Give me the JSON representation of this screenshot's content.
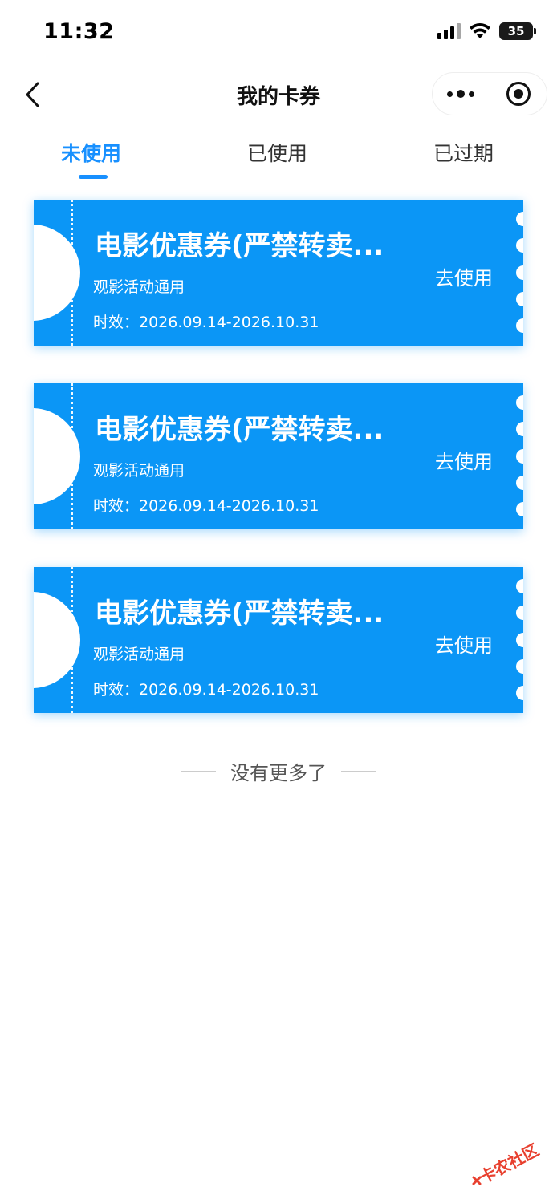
{
  "status_bar": {
    "time": "11:32",
    "battery": "35",
    "icons": [
      "signal-icon",
      "wifi-icon",
      "battery-icon"
    ]
  },
  "nav": {
    "title": "我的卡券",
    "back_icon": "chevron-left-icon",
    "more_icon": "more-dots-icon",
    "close_icon": "target-circle-icon"
  },
  "tabs": [
    {
      "label": "未使用",
      "active": true
    },
    {
      "label": "已使用",
      "active": false
    },
    {
      "label": "已过期",
      "active": false
    }
  ],
  "coupons": [
    {
      "title": "电影优惠券(严禁转卖...",
      "subtitle": "观影活动通用",
      "validity": "时效：2026.09.14-2026.10.31",
      "action": "去使用"
    },
    {
      "title": "电影优惠券(严禁转卖...",
      "subtitle": "观影活动通用",
      "validity": "时效：2026.09.14-2026.10.31",
      "action": "去使用"
    },
    {
      "title": "电影优惠券(严禁转卖...",
      "subtitle": "观影活动通用",
      "validity": "时效：2026.09.14-2026.10.31",
      "action": "去使用"
    }
  ],
  "footer": {
    "no_more": "没有更多了"
  },
  "colors": {
    "accent": "#1890ff",
    "coupon_bg": "#0b96f6",
    "watermark_red": "#e8402f"
  },
  "watermark": {
    "text": "卡农社区"
  }
}
